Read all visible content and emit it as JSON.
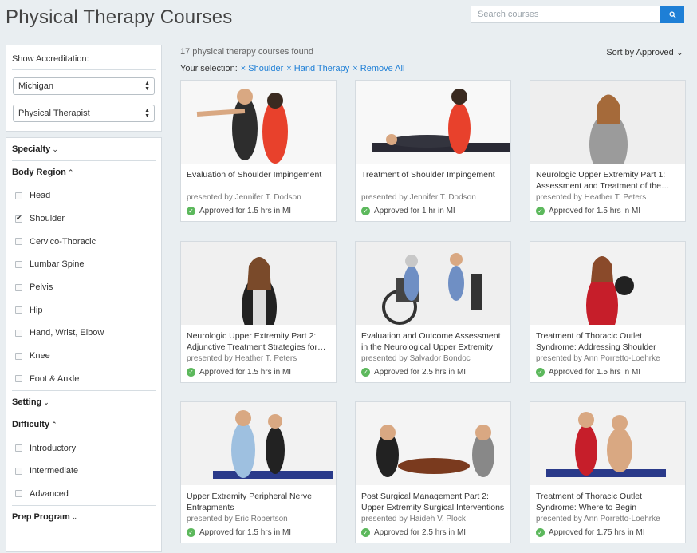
{
  "page": {
    "title": "Physical Therapy Courses"
  },
  "search": {
    "placeholder": "Search courses",
    "icon": "search-icon"
  },
  "accreditation": {
    "label": "Show Accreditation:",
    "state": "Michigan",
    "profession": "Physical Therapist"
  },
  "filters": {
    "specialty": {
      "label": "Specialty",
      "caret": "⌄"
    },
    "body_region": {
      "label": "Body Region",
      "caret": "⌃",
      "options": [
        {
          "label": "Head",
          "checked": false
        },
        {
          "label": "Shoulder",
          "checked": true
        },
        {
          "label": "Cervico-Thoracic",
          "checked": false
        },
        {
          "label": "Lumbar Spine",
          "checked": false
        },
        {
          "label": "Pelvis",
          "checked": false
        },
        {
          "label": "Hip",
          "checked": false
        },
        {
          "label": "Hand, Wrist, Elbow",
          "checked": false
        },
        {
          "label": "Knee",
          "checked": false
        },
        {
          "label": "Foot & Ankle",
          "checked": false
        }
      ]
    },
    "setting": {
      "label": "Setting",
      "caret": "⌄"
    },
    "difficulty": {
      "label": "Difficulty",
      "caret": "⌃",
      "options": [
        {
          "label": "Introductory",
          "checked": false
        },
        {
          "label": "Intermediate",
          "checked": false
        },
        {
          "label": "Advanced",
          "checked": false
        }
      ]
    },
    "prep_program": {
      "label": "Prep Program",
      "caret": "⌄"
    }
  },
  "results": {
    "count_text": "17 physical therapy courses found",
    "sort_label": "Sort by Approved ⌄",
    "selection_label": "Your selection:",
    "chips": [
      "× Shoulder",
      "× Hand Therapy",
      "× Remove All"
    ]
  },
  "courses": [
    {
      "title": "Evaluation of Shoulder Impingement",
      "presenter": "presented by Jennifer T. Dodson",
      "approved": "Approved for 1.5 hrs in MI"
    },
    {
      "title": "Treatment of Shoulder Impingement",
      "presenter": "presented by Jennifer T. Dodson",
      "approved": "Approved for 1 hr in MI"
    },
    {
      "title": "Neurologic Upper Extremity Part 1: Assessment and Treatment of the…",
      "presenter": "presented by Heather T. Peters",
      "approved": "Approved for 1.5 hrs in MI"
    },
    {
      "title": "Neurologic Upper Extremity Part 2: Adjunctive Treatment Strategies for…",
      "presenter": "presented by Heather T. Peters",
      "approved": "Approved for 1.5 hrs in MI"
    },
    {
      "title": "Evaluation and Outcome Assessment in the Neurological Upper Extremity",
      "presenter": "presented by Salvador Bondoc",
      "approved": "Approved for 2.5 hrs in MI"
    },
    {
      "title": "Treatment of Thoracic Outlet Syndrome: Addressing Shoulder and…",
      "presenter": "presented by Ann Porretto-Loehrke",
      "approved": "Approved for 1.5 hrs in MI"
    },
    {
      "title": "Upper Extremity Peripheral Nerve Entrapments",
      "presenter": "presented by Eric Robertson",
      "approved": "Approved for 1.5 hrs in MI"
    },
    {
      "title": "Post Surgical Management Part 2: Upper Extremity Surgical Interventions",
      "presenter": "presented by Haideh V. Plock",
      "approved": "Approved for 2.5 hrs in MI"
    },
    {
      "title": "Treatment of Thoracic Outlet Syndrome: Where to Begin",
      "presenter": "presented by Ann Porretto-Loehrke",
      "approved": "Approved for 1.75 hrs in MI"
    }
  ],
  "colors": {
    "accent": "#1e7fd6",
    "approved": "#5cb85c",
    "background": "#e9eef1"
  }
}
